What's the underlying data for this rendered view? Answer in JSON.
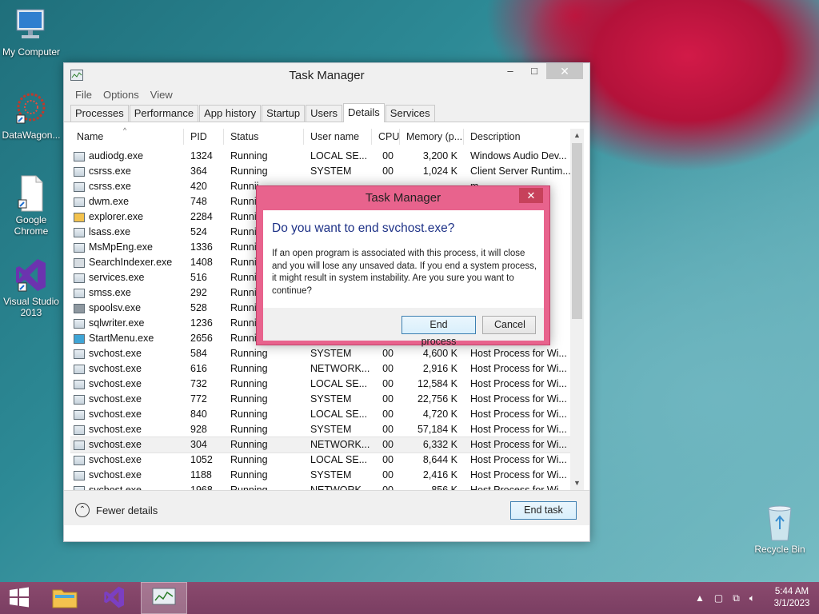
{
  "desktop": {
    "icons": [
      {
        "label": "My Computer",
        "icon": "computer-icon"
      },
      {
        "label": "DataWagon...",
        "icon": "datawagon-icon"
      },
      {
        "label": "Google Chrome",
        "icon": "document-shortcut-icon"
      },
      {
        "label": "Visual Studio 2013",
        "icon": "visual-studio-icon"
      },
      {
        "label": "Recycle Bin",
        "icon": "recycle-bin-icon"
      }
    ]
  },
  "task_manager": {
    "title": "Task Manager",
    "menu": [
      "File",
      "Options",
      "View"
    ],
    "tabs": [
      "Processes",
      "Performance",
      "App history",
      "Startup",
      "Users",
      "Details",
      "Services"
    ],
    "active_tab": "Details",
    "columns": [
      "Name",
      "PID",
      "Status",
      "User name",
      "CPU",
      "Memory (p...",
      "Description"
    ],
    "rows": [
      {
        "name": "audiodg.exe",
        "pid": "1324",
        "status": "Running",
        "user": "LOCAL SE...",
        "cpu": "00",
        "mem": "3,200 K",
        "desc": "Windows Audio Dev..."
      },
      {
        "name": "csrss.exe",
        "pid": "364",
        "status": "Running",
        "user": "SYSTEM",
        "cpu": "00",
        "mem": "1,024 K",
        "desc": "Client Server Runtim..."
      },
      {
        "name": "csrss.exe",
        "pid": "420",
        "status": "Runnii",
        "user": "",
        "cpu": "",
        "mem": "",
        "desc": "m..."
      },
      {
        "name": "dwm.exe",
        "pid": "748",
        "status": "Runnii",
        "user": "",
        "cpu": "",
        "mem": "",
        "desc": ""
      },
      {
        "name": "explorer.exe",
        "pid": "2284",
        "status": "Runnii",
        "user": "",
        "cpu": "",
        "mem": "",
        "desc": ""
      },
      {
        "name": "lsass.exe",
        "pid": "524",
        "status": "Runnii",
        "user": "",
        "cpu": "",
        "mem": "",
        "desc": ""
      },
      {
        "name": "MsMpEng.exe",
        "pid": "1336",
        "status": "Runnii",
        "user": "",
        "cpu": "",
        "mem": "",
        "desc": ""
      },
      {
        "name": "SearchIndexer.exe",
        "pid": "1408",
        "status": "Runnii",
        "user": "",
        "cpu": "",
        "mem": "",
        "desc": "s..."
      },
      {
        "name": "services.exe",
        "pid": "516",
        "status": "Runnii",
        "user": "",
        "cpu": "",
        "mem": "",
        "desc": "ol..."
      },
      {
        "name": "smss.exe",
        "pid": "292",
        "status": "Runnii",
        "user": "",
        "cpu": "",
        "mem": "",
        "desc": "M..."
      },
      {
        "name": "spoolsv.exe",
        "pid": "528",
        "status": "Runnii",
        "user": "",
        "cpu": "",
        "mem": "",
        "desc": ""
      },
      {
        "name": "sqlwriter.exe",
        "pid": "1236",
        "status": "Runnii",
        "user": "",
        "cpu": "",
        "mem": "",
        "desc": ""
      },
      {
        "name": "StartMenu.exe",
        "pid": "2656",
        "status": "Runnii",
        "user": "",
        "cpu": "",
        "mem": "",
        "desc": ""
      },
      {
        "name": "svchost.exe",
        "pid": "584",
        "status": "Running",
        "user": "SYSTEM",
        "cpu": "00",
        "mem": "4,600 K",
        "desc": "Host Process for Wi..."
      },
      {
        "name": "svchost.exe",
        "pid": "616",
        "status": "Running",
        "user": "NETWORK...",
        "cpu": "00",
        "mem": "2,916 K",
        "desc": "Host Process for Wi..."
      },
      {
        "name": "svchost.exe",
        "pid": "732",
        "status": "Running",
        "user": "LOCAL SE...",
        "cpu": "00",
        "mem": "12,584 K",
        "desc": "Host Process for Wi..."
      },
      {
        "name": "svchost.exe",
        "pid": "772",
        "status": "Running",
        "user": "SYSTEM",
        "cpu": "00",
        "mem": "22,756 K",
        "desc": "Host Process for Wi..."
      },
      {
        "name": "svchost.exe",
        "pid": "840",
        "status": "Running",
        "user": "LOCAL SE...",
        "cpu": "00",
        "mem": "4,720 K",
        "desc": "Host Process for Wi..."
      },
      {
        "name": "svchost.exe",
        "pid": "928",
        "status": "Running",
        "user": "SYSTEM",
        "cpu": "00",
        "mem": "57,184 K",
        "desc": "Host Process for Wi..."
      },
      {
        "name": "svchost.exe",
        "pid": "304",
        "status": "Running",
        "user": "NETWORK...",
        "cpu": "00",
        "mem": "6,332 K",
        "desc": "Host Process for Wi...",
        "selected": true
      },
      {
        "name": "svchost.exe",
        "pid": "1052",
        "status": "Running",
        "user": "LOCAL SE...",
        "cpu": "00",
        "mem": "8,644 K",
        "desc": "Host Process for Wi..."
      },
      {
        "name": "svchost.exe",
        "pid": "1188",
        "status": "Running",
        "user": "SYSTEM",
        "cpu": "00",
        "mem": "2,416 K",
        "desc": "Host Process for Wi..."
      },
      {
        "name": "svchost.exe",
        "pid": "1968",
        "status": "Running",
        "user": "NETWORK...",
        "cpu": "00",
        "mem": "856 K",
        "desc": "Host Process for Wi..."
      }
    ],
    "fewer_details": "Fewer details",
    "end_task": "End task"
  },
  "dialog": {
    "title": "Task Manager",
    "close": "✕",
    "heading": "Do you want to end svchost.exe?",
    "body": "If an open program is associated with this process, it will close and you will lose any unsaved data. If you end a system process, it might result in system instability. Are you sure you want to continue?",
    "end_process": "End process",
    "cancel": "Cancel"
  },
  "taskbar": {
    "time": "5:44 AM",
    "date": "3/1/2023"
  },
  "colors": {
    "dialog_accent": "#e8638d",
    "taskbar": "#8b4a6e",
    "heading_blue": "#1e3287"
  }
}
